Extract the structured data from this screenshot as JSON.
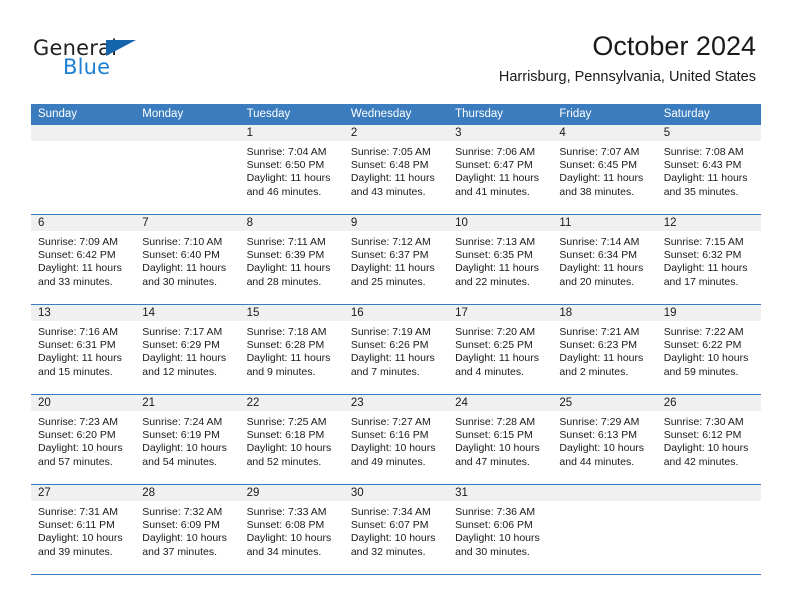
{
  "logo": {
    "word_top": "General",
    "word_bottom": "Blue",
    "triangle_color": "#1565ad",
    "blue_color": "#1c7fd4",
    "dark_color": "#231f20"
  },
  "header": {
    "title": "October 2024",
    "subtitle": "Harrisburg, Pennsylvania, United States"
  },
  "theme": {
    "header_blue": "#3a7cbe",
    "daynum_band": "#f0f0f0",
    "cell_bg": "#ffffff",
    "text": "#1a1a1a"
  },
  "weekday_headers": [
    "Sunday",
    "Monday",
    "Tuesday",
    "Wednesday",
    "Thursday",
    "Friday",
    "Saturday"
  ],
  "weeks": [
    [
      {
        "day": "",
        "sunrise": "",
        "sunset": "",
        "daylight1": "",
        "daylight2": ""
      },
      {
        "day": "",
        "sunrise": "",
        "sunset": "",
        "daylight1": "",
        "daylight2": ""
      },
      {
        "day": "1",
        "sunrise": "Sunrise: 7:04 AM",
        "sunset": "Sunset: 6:50 PM",
        "daylight1": "Daylight: 11 hours",
        "daylight2": "and 46 minutes."
      },
      {
        "day": "2",
        "sunrise": "Sunrise: 7:05 AM",
        "sunset": "Sunset: 6:48 PM",
        "daylight1": "Daylight: 11 hours",
        "daylight2": "and 43 minutes."
      },
      {
        "day": "3",
        "sunrise": "Sunrise: 7:06 AM",
        "sunset": "Sunset: 6:47 PM",
        "daylight1": "Daylight: 11 hours",
        "daylight2": "and 41 minutes."
      },
      {
        "day": "4",
        "sunrise": "Sunrise: 7:07 AM",
        "sunset": "Sunset: 6:45 PM",
        "daylight1": "Daylight: 11 hours",
        "daylight2": "and 38 minutes."
      },
      {
        "day": "5",
        "sunrise": "Sunrise: 7:08 AM",
        "sunset": "Sunset: 6:43 PM",
        "daylight1": "Daylight: 11 hours",
        "daylight2": "and 35 minutes."
      }
    ],
    [
      {
        "day": "6",
        "sunrise": "Sunrise: 7:09 AM",
        "sunset": "Sunset: 6:42 PM",
        "daylight1": "Daylight: 11 hours",
        "daylight2": "and 33 minutes."
      },
      {
        "day": "7",
        "sunrise": "Sunrise: 7:10 AM",
        "sunset": "Sunset: 6:40 PM",
        "daylight1": "Daylight: 11 hours",
        "daylight2": "and 30 minutes."
      },
      {
        "day": "8",
        "sunrise": "Sunrise: 7:11 AM",
        "sunset": "Sunset: 6:39 PM",
        "daylight1": "Daylight: 11 hours",
        "daylight2": "and 28 minutes."
      },
      {
        "day": "9",
        "sunrise": "Sunrise: 7:12 AM",
        "sunset": "Sunset: 6:37 PM",
        "daylight1": "Daylight: 11 hours",
        "daylight2": "and 25 minutes."
      },
      {
        "day": "10",
        "sunrise": "Sunrise: 7:13 AM",
        "sunset": "Sunset: 6:35 PM",
        "daylight1": "Daylight: 11 hours",
        "daylight2": "and 22 minutes."
      },
      {
        "day": "11",
        "sunrise": "Sunrise: 7:14 AM",
        "sunset": "Sunset: 6:34 PM",
        "daylight1": "Daylight: 11 hours",
        "daylight2": "and 20 minutes."
      },
      {
        "day": "12",
        "sunrise": "Sunrise: 7:15 AM",
        "sunset": "Sunset: 6:32 PM",
        "daylight1": "Daylight: 11 hours",
        "daylight2": "and 17 minutes."
      }
    ],
    [
      {
        "day": "13",
        "sunrise": "Sunrise: 7:16 AM",
        "sunset": "Sunset: 6:31 PM",
        "daylight1": "Daylight: 11 hours",
        "daylight2": "and 15 minutes."
      },
      {
        "day": "14",
        "sunrise": "Sunrise: 7:17 AM",
        "sunset": "Sunset: 6:29 PM",
        "daylight1": "Daylight: 11 hours",
        "daylight2": "and 12 minutes."
      },
      {
        "day": "15",
        "sunrise": "Sunrise: 7:18 AM",
        "sunset": "Sunset: 6:28 PM",
        "daylight1": "Daylight: 11 hours",
        "daylight2": "and 9 minutes."
      },
      {
        "day": "16",
        "sunrise": "Sunrise: 7:19 AM",
        "sunset": "Sunset: 6:26 PM",
        "daylight1": "Daylight: 11 hours",
        "daylight2": "and 7 minutes."
      },
      {
        "day": "17",
        "sunrise": "Sunrise: 7:20 AM",
        "sunset": "Sunset: 6:25 PM",
        "daylight1": "Daylight: 11 hours",
        "daylight2": "and 4 minutes."
      },
      {
        "day": "18",
        "sunrise": "Sunrise: 7:21 AM",
        "sunset": "Sunset: 6:23 PM",
        "daylight1": "Daylight: 11 hours",
        "daylight2": "and 2 minutes."
      },
      {
        "day": "19",
        "sunrise": "Sunrise: 7:22 AM",
        "sunset": "Sunset: 6:22 PM",
        "daylight1": "Daylight: 10 hours",
        "daylight2": "and 59 minutes."
      }
    ],
    [
      {
        "day": "20",
        "sunrise": "Sunrise: 7:23 AM",
        "sunset": "Sunset: 6:20 PM",
        "daylight1": "Daylight: 10 hours",
        "daylight2": "and 57 minutes."
      },
      {
        "day": "21",
        "sunrise": "Sunrise: 7:24 AM",
        "sunset": "Sunset: 6:19 PM",
        "daylight1": "Daylight: 10 hours",
        "daylight2": "and 54 minutes."
      },
      {
        "day": "22",
        "sunrise": "Sunrise: 7:25 AM",
        "sunset": "Sunset: 6:18 PM",
        "daylight1": "Daylight: 10 hours",
        "daylight2": "and 52 minutes."
      },
      {
        "day": "23",
        "sunrise": "Sunrise: 7:27 AM",
        "sunset": "Sunset: 6:16 PM",
        "daylight1": "Daylight: 10 hours",
        "daylight2": "and 49 minutes."
      },
      {
        "day": "24",
        "sunrise": "Sunrise: 7:28 AM",
        "sunset": "Sunset: 6:15 PM",
        "daylight1": "Daylight: 10 hours",
        "daylight2": "and 47 minutes."
      },
      {
        "day": "25",
        "sunrise": "Sunrise: 7:29 AM",
        "sunset": "Sunset: 6:13 PM",
        "daylight1": "Daylight: 10 hours",
        "daylight2": "and 44 minutes."
      },
      {
        "day": "26",
        "sunrise": "Sunrise: 7:30 AM",
        "sunset": "Sunset: 6:12 PM",
        "daylight1": "Daylight: 10 hours",
        "daylight2": "and 42 minutes."
      }
    ],
    [
      {
        "day": "27",
        "sunrise": "Sunrise: 7:31 AM",
        "sunset": "Sunset: 6:11 PM",
        "daylight1": "Daylight: 10 hours",
        "daylight2": "and 39 minutes."
      },
      {
        "day": "28",
        "sunrise": "Sunrise: 7:32 AM",
        "sunset": "Sunset: 6:09 PM",
        "daylight1": "Daylight: 10 hours",
        "daylight2": "and 37 minutes."
      },
      {
        "day": "29",
        "sunrise": "Sunrise: 7:33 AM",
        "sunset": "Sunset: 6:08 PM",
        "daylight1": "Daylight: 10 hours",
        "daylight2": "and 34 minutes."
      },
      {
        "day": "30",
        "sunrise": "Sunrise: 7:34 AM",
        "sunset": "Sunset: 6:07 PM",
        "daylight1": "Daylight: 10 hours",
        "daylight2": "and 32 minutes."
      },
      {
        "day": "31",
        "sunrise": "Sunrise: 7:36 AM",
        "sunset": "Sunset: 6:06 PM",
        "daylight1": "Daylight: 10 hours",
        "daylight2": "and 30 minutes."
      },
      {
        "day": "",
        "sunrise": "",
        "sunset": "",
        "daylight1": "",
        "daylight2": ""
      },
      {
        "day": "",
        "sunrise": "",
        "sunset": "",
        "daylight1": "",
        "daylight2": ""
      }
    ]
  ]
}
